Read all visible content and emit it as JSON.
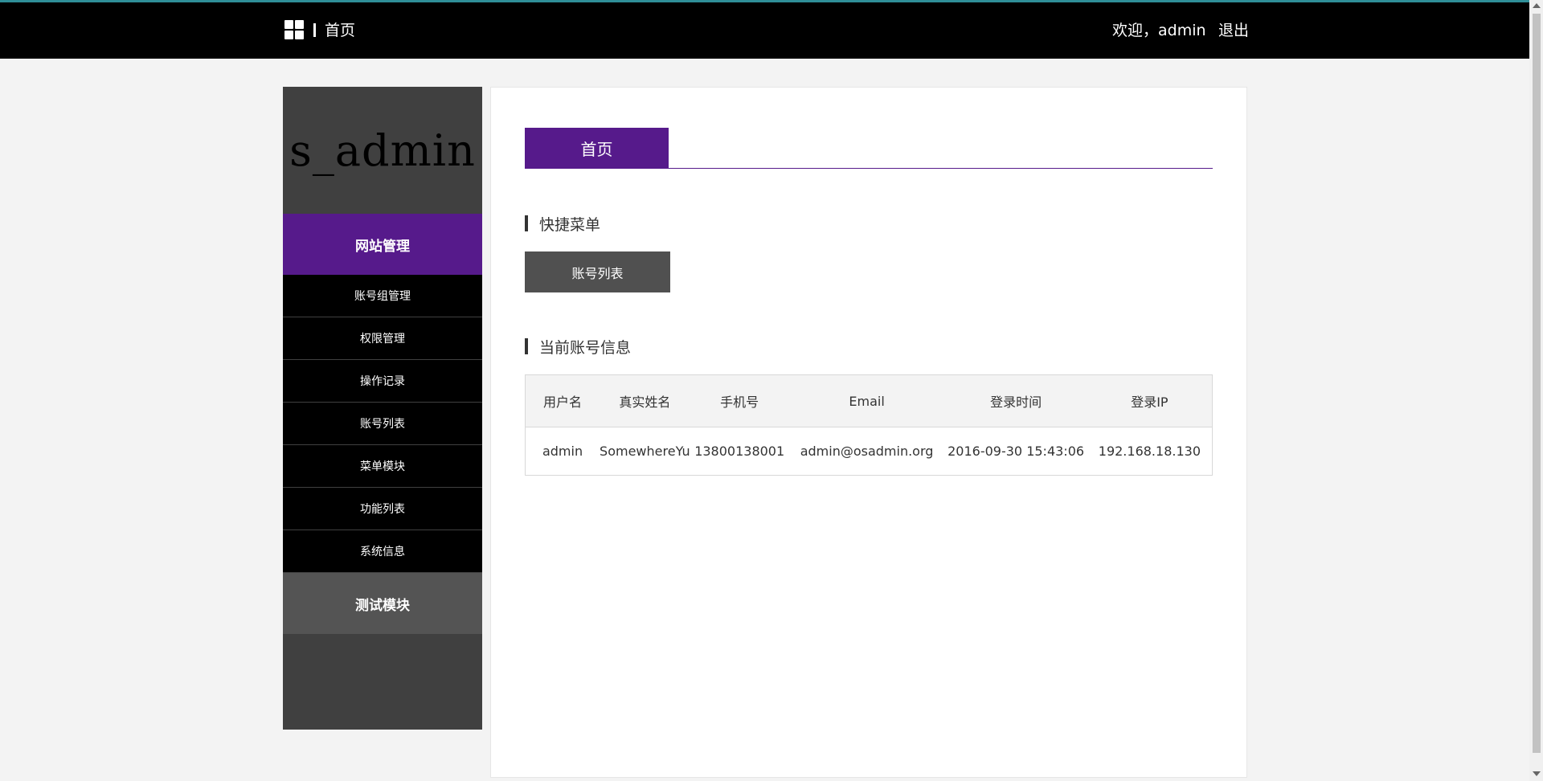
{
  "header": {
    "home_label": "首页",
    "welcome": "欢迎，admin",
    "logout": "退出"
  },
  "sidebar": {
    "brand": "s_admin",
    "groups": [
      {
        "label": "网站管理",
        "items": [
          "账号组管理",
          "权限管理",
          "操作记录",
          "账号列表",
          "菜单模块",
          "功能列表",
          "系统信息"
        ]
      },
      {
        "label": "测试模块"
      }
    ]
  },
  "main": {
    "tab": "首页",
    "quick_menu_title": "快捷菜单",
    "quick_button": "账号列表",
    "account_info_title": "当前账号信息",
    "table": {
      "headers": [
        "用户名",
        "真实姓名",
        "手机号",
        "Email",
        "登录时间",
        "登录IP"
      ],
      "rows": [
        [
          "admin",
          "SomewhereYu",
          "13800138001",
          "admin@osadmin.org",
          "2016-09-30 15:43:06",
          "192.168.18.130"
        ]
      ]
    }
  },
  "colors": {
    "accent": "#561a8b",
    "topbar": "#000000",
    "sidebar": "#404040"
  }
}
